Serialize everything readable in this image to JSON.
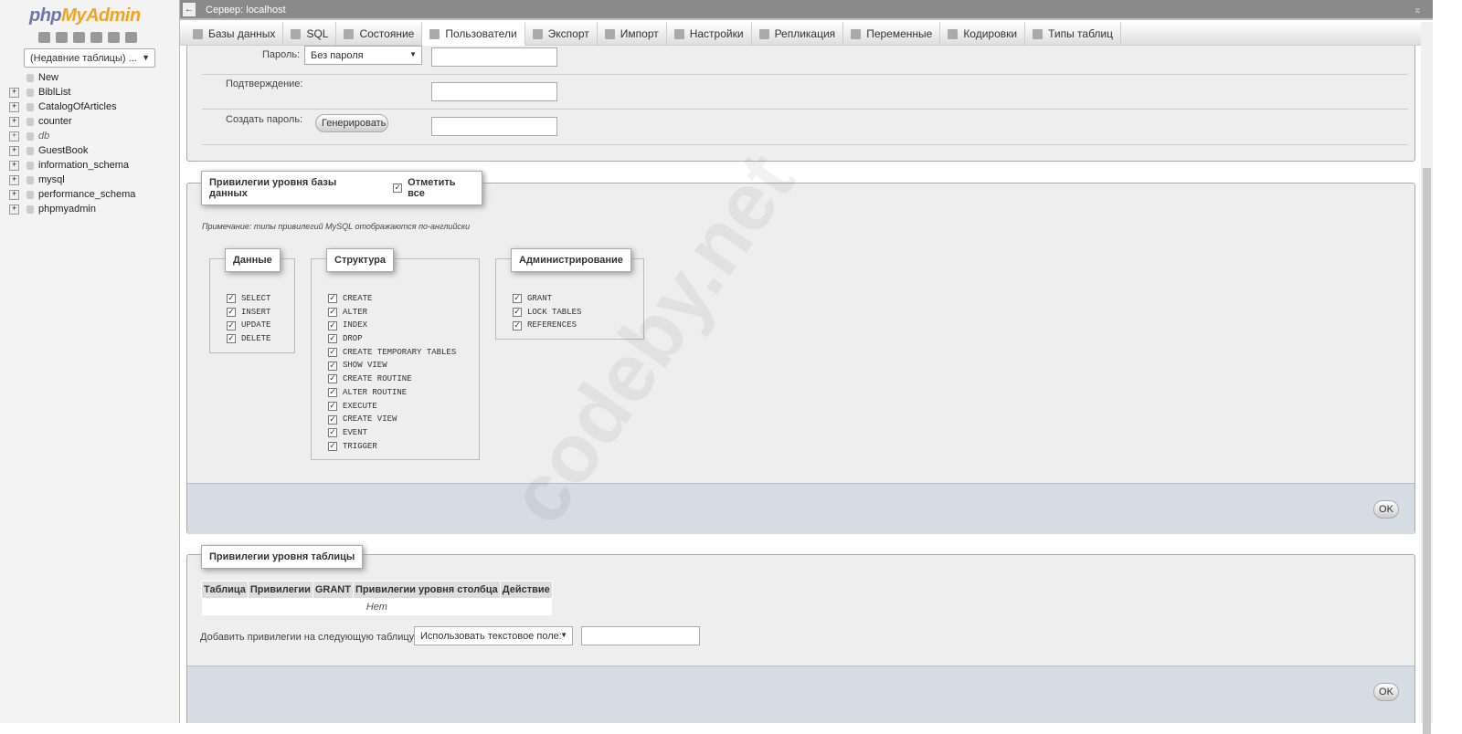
{
  "sidebar": {
    "logo_php": "php",
    "logo_myadmin": "MyAdmin",
    "recent_tables": "(Недавние таблицы) ...",
    "databases": [
      "New",
      "BiblList",
      "CatalogOfArticles",
      "counter",
      "db",
      "GuestBook",
      "information_schema",
      "mysql",
      "performance_schema",
      "phpmyadmin"
    ]
  },
  "topbar": {
    "server": "Сервер: localhost"
  },
  "tabs": [
    "Базы данных",
    "SQL",
    "Состояние",
    "Пользователи",
    "Экспорт",
    "Импорт",
    "Настройки",
    "Репликация",
    "Переменные",
    "Кодировки",
    "Типы таблиц"
  ],
  "password": {
    "password_label": "Пароль:",
    "password_select": "Без пароля",
    "confirm_label": "Подтверждение:",
    "generate_label": "Создать пароль:",
    "generate_button": "Генерировать"
  },
  "db_privileges": {
    "legend": "Привилегии уровня базы данных",
    "check_all": "Отметить все",
    "note": "Примечание: типы привилегий MySQL отображаются по-английски",
    "groups": [
      {
        "title": "Данные",
        "items": [
          "SELECT",
          "INSERT",
          "UPDATE",
          "DELETE"
        ]
      },
      {
        "title": "Структура",
        "items": [
          "CREATE",
          "ALTER",
          "INDEX",
          "DROP",
          "CREATE TEMPORARY TABLES",
          "SHOW VIEW",
          "CREATE ROUTINE",
          "ALTER ROUTINE",
          "EXECUTE",
          "CREATE VIEW",
          "EVENT",
          "TRIGGER"
        ]
      },
      {
        "title": "Администрирование",
        "items": [
          "GRANT",
          "LOCK TABLES",
          "REFERENCES"
        ]
      }
    ],
    "ok": "OK"
  },
  "table_privileges": {
    "legend": "Привилегии уровня таблицы",
    "columns": [
      "Таблица",
      "Привилегии",
      "GRANT",
      "Привилегии уровня столбца",
      "Действие"
    ],
    "empty": "Нет",
    "add_label": "Добавить привилегии на следующую таблицу:",
    "add_select": "Использовать текстовое поле:",
    "ok": "OK"
  },
  "watermark": "codeby.net"
}
